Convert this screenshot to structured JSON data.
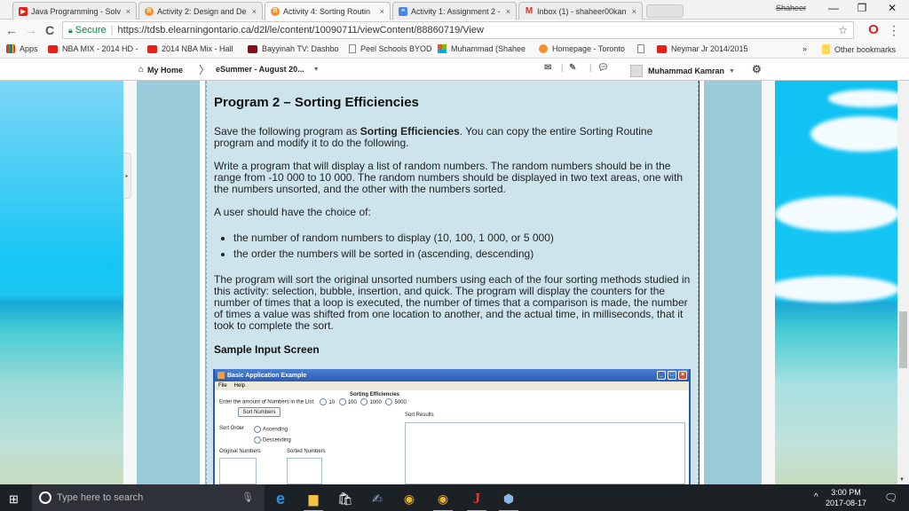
{
  "browser": {
    "tabs": [
      {
        "title": "Java Programming - Solv",
        "icon": "youtube-icon",
        "active": false
      },
      {
        "title": "Activity 2: Design and De",
        "icon": "brightspace-icon",
        "active": false
      },
      {
        "title": "Activity 4: Sorting Routin",
        "icon": "brightspace-icon",
        "active": true
      },
      {
        "title": "Activity 1: Assignment 2 -",
        "icon": "google-docs-icon",
        "active": false
      },
      {
        "title": "Inbox (1) - shaheer00kan",
        "icon": "gmail-icon",
        "active": false
      }
    ],
    "tab_close": "×",
    "profile_name": "Shaheer",
    "window_controls": {
      "minimize": "—",
      "restore": "❐",
      "close": "✕"
    },
    "nav": {
      "back": "←",
      "forward": "→",
      "reload": "C"
    },
    "address": {
      "secure_label": "Secure",
      "url": "https://tdsb.elearningontario.ca/d2l/le/content/10090711/viewContent/88860719/View"
    },
    "bookmarks": [
      {
        "label": "Apps",
        "icon": "apps-grid-icon"
      },
      {
        "label": "NBA MIX - 2014 HD -",
        "icon": "youtube-icon"
      },
      {
        "label": "2014 NBA Mix - Hall",
        "icon": "youtube-icon"
      },
      {
        "label": "Bayyinah TV: Dashbo",
        "icon": "bayyinah-icon"
      },
      {
        "label": "Peel Schools BYOD",
        "icon": "page-icon"
      },
      {
        "label": "Muhammad (Shahee",
        "icon": "microsoft-icon"
      },
      {
        "label": "Homepage - Toronto",
        "icon": "brightspace-icon"
      },
      {
        "label": "",
        "icon": "page-icon"
      },
      {
        "label": "Neymar Jr 2014/2015",
        "icon": "youtube-icon"
      }
    ],
    "bookmarks_overflow": "»",
    "other_bookmarks": "Other bookmarks"
  },
  "d2l": {
    "home": "My Home",
    "course": "eSummer - August 20...",
    "user": "Muhammad Kamran"
  },
  "content": {
    "heading": "Program 2 – Sorting Efficiencies",
    "p1_before": "Save the following program as ",
    "p1_bold": "Sorting Efficiencies",
    "p1_after": ". You can copy the entire Sorting Routine program and modify it to do the following.",
    "p2": "Write a program that will display a list of random numbers. The random numbers should be in the range from -10 000 to 10 000. The random numbers should be displayed in two text areas, one with the numbers unsorted, and the other with the numbers sorted.",
    "p3": "A user should have the choice of:",
    "bullets": [
      "the number of random numbers to display (10, 100, 1 000, or 5 000)",
      "the order the numbers will be sorted in (ascending, descending)"
    ],
    "p4": "The program will sort the original unsorted numbers using each of the four sorting methods studied in this activity: selection, bubble, insertion, and quick. The program will display the counters for the number of times that a loop is executed, the number of times that a comparison is made, the number of times a value was shifted from one location to another, and the actual time, in milliseconds, that it took to complete the sort.",
    "sample_heading": "Sample Input Screen"
  },
  "java_app": {
    "title": "Basic Application Example",
    "menu": [
      "File",
      "Help"
    ],
    "heading": "Sorting Efficiencies",
    "amount_label": "Enter the amount of Numbers in the List:",
    "amount_options": [
      "10",
      "100",
      "1000",
      "5000"
    ],
    "sort_button": "Sort Numbers",
    "sort_order_label": "Sort Order",
    "order_options": [
      "Ascending",
      "Descending"
    ],
    "original_label": "Original Numbers",
    "sorted_label": "Sorted Numbers",
    "results_label": "Sort Results"
  },
  "taskbar": {
    "search_placeholder": "Type here to search",
    "time": "3:00 PM",
    "date": "2017-08-17"
  }
}
